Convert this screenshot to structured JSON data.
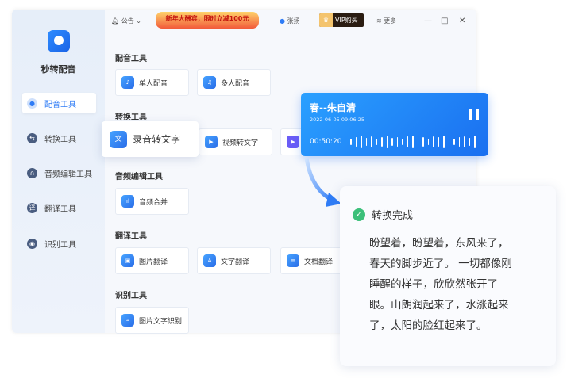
{
  "app": {
    "name": "秒转配音"
  },
  "sidebar": {
    "items": [
      {
        "label": "配音工具",
        "icon": "mic-icon",
        "active": true
      },
      {
        "label": "转换工具",
        "icon": "swap-icon"
      },
      {
        "label": "音频编辑工具",
        "icon": "headphones-icon"
      },
      {
        "label": "翻译工具",
        "icon": "translate-icon"
      },
      {
        "label": "识别工具",
        "icon": "eye-icon"
      }
    ]
  },
  "topbar": {
    "notice": "公告",
    "promo": "新年大酬宾，限时立减100元",
    "user": "张扬",
    "vip": "VIP购买",
    "more": "更多"
  },
  "sections": [
    {
      "title": "配音工具",
      "cards": [
        "单人配音",
        "多人配音"
      ]
    },
    {
      "title": "转换工具",
      "cards": [
        "录音转文字",
        "视频转文字"
      ]
    },
    {
      "title": "音频编辑工具",
      "cards": [
        "音频合并"
      ]
    },
    {
      "title": "翻译工具",
      "cards": [
        "图片翻译",
        "文字翻译",
        "文档翻译"
      ]
    },
    {
      "title": "识别工具",
      "cards": [
        "图片文字识别"
      ]
    }
  ],
  "player": {
    "title": "春--朱自清",
    "date": "2022-06-05 09:06:25",
    "time": "00:50:20"
  },
  "result": {
    "status": "转换完成",
    "text": "盼望着，盼望着，东风来了，\n春天的脚步近了。  一切都像刚\n睡醒的样子，欣欣然张开了\n眼。山朗润起来了，水涨起来\n了，太阳的脸红起来了。"
  },
  "colors": {
    "accent": "#2f7cf6",
    "success": "#3cc07a"
  }
}
